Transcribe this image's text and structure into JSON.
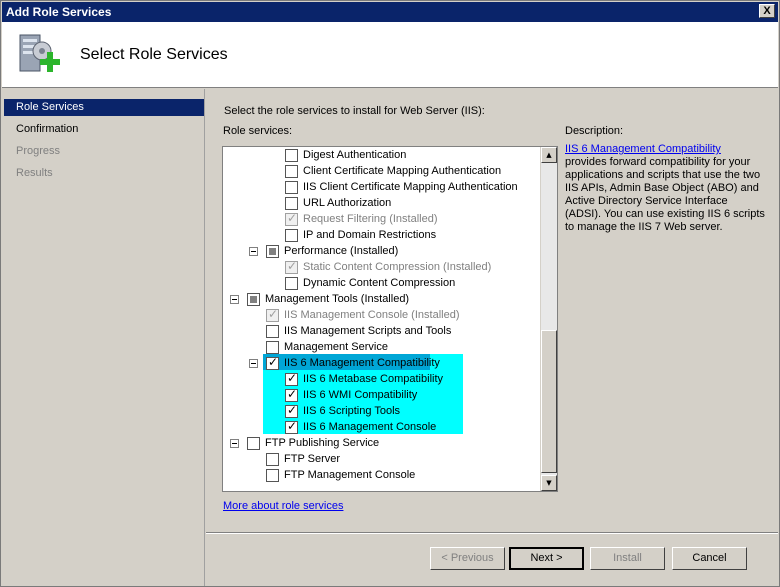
{
  "window": {
    "title": "Add Role Services",
    "close_label": "X"
  },
  "header": {
    "title": "Select Role Services",
    "icon": "server-add-icon"
  },
  "nav": [
    {
      "label": "Role Services",
      "state": "active"
    },
    {
      "label": "Confirmation",
      "state": "normal"
    },
    {
      "label": "Progress",
      "state": "disabled"
    },
    {
      "label": "Results",
      "state": "disabled"
    }
  ],
  "main": {
    "instruction": "Select the role services to install for Web Server (IIS):",
    "services_label": "Role services:",
    "description_label": "Description:",
    "description_link": "IIS 6 Management Compatibility",
    "description_text": " provides forward compatibility for your applications and scripts that use the two IIS APIs, Admin Base Object (ABO) and Active Directory Service Interface (ADSI). You can use existing IIS 6 scripts to manage the IIS 7 Web server.",
    "more_link": "More about role services"
  },
  "tree": [
    {
      "label": "Digest Authentication",
      "state": "unchecked",
      "disabled": false
    },
    {
      "label": "Client Certificate Mapping Authentication",
      "state": "unchecked",
      "disabled": false
    },
    {
      "label": "IIS Client Certificate Mapping Authentication",
      "state": "unchecked",
      "disabled": false
    },
    {
      "label": "URL Authorization",
      "state": "unchecked",
      "disabled": false
    },
    {
      "label": "Request Filtering  (Installed)",
      "state": "checked",
      "disabled": true
    },
    {
      "label": "IP and Domain Restrictions",
      "state": "unchecked",
      "disabled": false
    },
    {
      "label": "Performance  (Installed)",
      "state": "partial",
      "disabled": false
    },
    {
      "label": "Static Content Compression  (Installed)",
      "state": "checked",
      "disabled": true
    },
    {
      "label": "Dynamic Content Compression",
      "state": "unchecked",
      "disabled": false
    },
    {
      "label": "Management Tools  (Installed)",
      "state": "partial",
      "disabled": false
    },
    {
      "label": "IIS Management Console  (Installed)",
      "state": "checked",
      "disabled": true
    },
    {
      "label": "IIS Management Scripts and Tools",
      "state": "unchecked",
      "disabled": false
    },
    {
      "label": "Management Service",
      "state": "unchecked",
      "disabled": false
    },
    {
      "label": "IIS 6 Management Compatibility",
      "state": "checked",
      "disabled": false,
      "selected": true
    },
    {
      "label": "IIS 6 Metabase Compatibility",
      "state": "checked",
      "disabled": false
    },
    {
      "label": "IIS 6 WMI Compatibility",
      "state": "checked",
      "disabled": false
    },
    {
      "label": "IIS 6 Scripting Tools",
      "state": "checked",
      "disabled": false
    },
    {
      "label": "IIS 6 Management Console",
      "state": "checked",
      "disabled": false
    },
    {
      "label": "FTP Publishing Service",
      "state": "unchecked",
      "disabled": false
    },
    {
      "label": "FTP Server",
      "state": "unchecked",
      "disabled": false
    },
    {
      "label": "FTP Management Console",
      "state": "unchecked",
      "disabled": false
    }
  ],
  "buttons": {
    "previous": "< Previous",
    "next": "Next >",
    "install": "Install",
    "cancel": "Cancel"
  },
  "colors": {
    "selection": "#00a6d6",
    "highlight": "#00ffff",
    "titlebar": "#0a246a",
    "link": "#0000ee"
  }
}
